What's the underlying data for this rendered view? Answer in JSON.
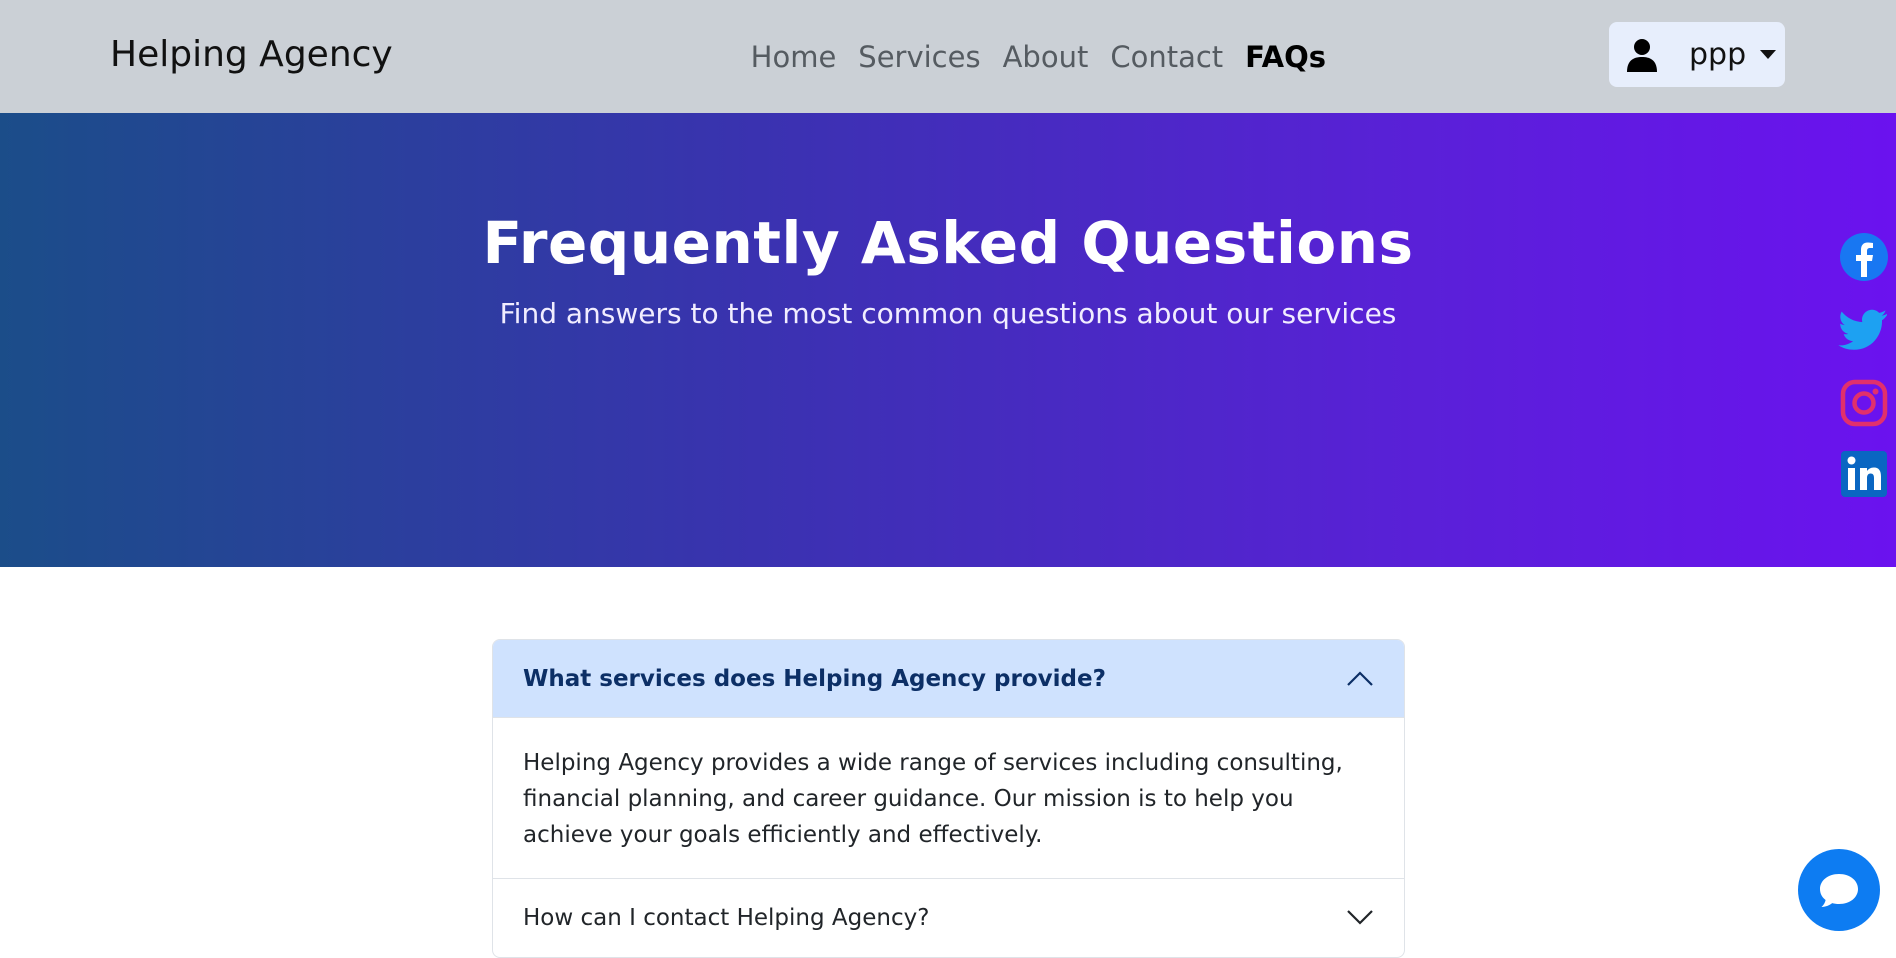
{
  "navbar": {
    "brand": "Helping Agency",
    "links": [
      {
        "label": "Home"
      },
      {
        "label": "Services"
      },
      {
        "label": "About"
      },
      {
        "label": "Contact"
      },
      {
        "label": "FAQs",
        "active": true
      }
    ],
    "user": {
      "name": "ppp",
      "icon": "person-icon"
    }
  },
  "hero": {
    "title": "Frequently Asked Questions",
    "subtitle": "Find answers to the most common questions about our services",
    "gradient_start": "#1b4d89",
    "gradient_end": "#6b12ef"
  },
  "social": [
    {
      "name": "facebook-icon",
      "color": "#1877f2"
    },
    {
      "name": "twitter-icon",
      "color": "#1da1f2"
    },
    {
      "name": "instagram-icon",
      "color": "#e1306c"
    },
    {
      "name": "linkedin-icon",
      "color": "#0a66c2"
    }
  ],
  "faq": [
    {
      "question": "What services does Helping Agency provide?",
      "answer": "Helping Agency provides a wide range of services including consulting, financial planning, and career guidance. Our mission is to help you achieve your goals efficiently and effectively.",
      "expanded": true
    },
    {
      "question": "How can I contact Helping Agency?",
      "expanded": false
    }
  ],
  "chat": {
    "icon": "chat-bubble-icon",
    "color": "#0d7cf2"
  }
}
